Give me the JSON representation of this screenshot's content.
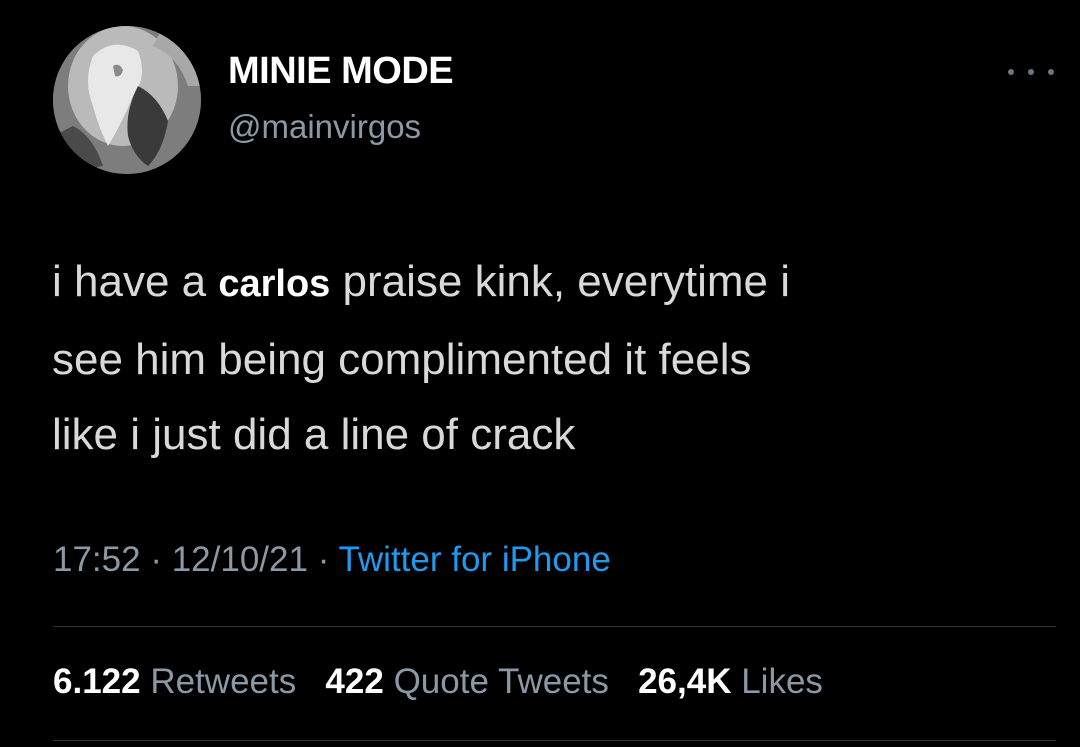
{
  "user": {
    "display_name": "MINIE MODE",
    "handle": "@mainvirgos",
    "avatar": "classical-engraving-avatar"
  },
  "menu_icon": "more-horizontal-icon",
  "tweet": {
    "line1_before": "i have a ",
    "highlight": "carlos",
    "line1_after": " praise kink, everytime i",
    "line2": "see him being complimented it feels",
    "line3": "like i just did a line of crack"
  },
  "meta": {
    "time": "17:52",
    "date": "12/10/21",
    "separator": "·",
    "source": "Twitter for iPhone"
  },
  "stats": {
    "retweets_count": "6.122",
    "retweets_label": "Retweets",
    "quotes_count": "422",
    "quotes_label": "Quote Tweets",
    "likes_count": "26,4K",
    "likes_label": "Likes"
  },
  "colors": {
    "background": "#000000",
    "text": "#d9d9d9",
    "muted": "#8b98a5",
    "link": "#1d9bf0",
    "divider": "#2f3336"
  }
}
